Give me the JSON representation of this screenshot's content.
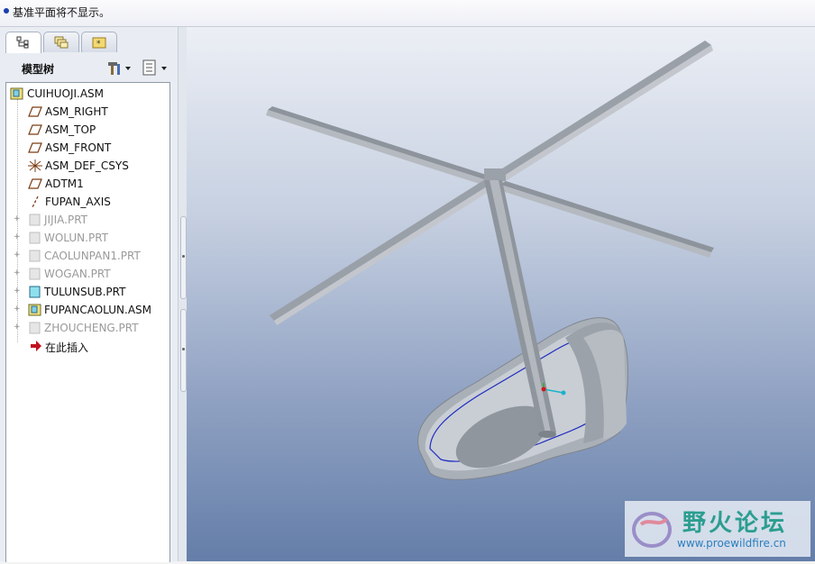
{
  "message_bar": {
    "text": "基准平面将不显示。"
  },
  "left_panel": {
    "tabs": [
      {
        "name": "model-tree-tab",
        "icon": "model-tree-icon"
      },
      {
        "name": "folder-browser-tab",
        "icon": "layers-icon"
      },
      {
        "name": "favorites-tab",
        "icon": "favorites-folder-icon"
      }
    ],
    "tree_title": "模型树",
    "tools": {
      "settings_icon": "hammer-settings-icon",
      "show_icon": "list-show-icon"
    }
  },
  "tree": {
    "root": "CUIHUOJI.ASM",
    "items": [
      {
        "label": "ASM_RIGHT",
        "icon": "datum-plane-icon",
        "dim": false
      },
      {
        "label": "ASM_TOP",
        "icon": "datum-plane-icon",
        "dim": false
      },
      {
        "label": "ASM_FRONT",
        "icon": "datum-plane-icon",
        "dim": false
      },
      {
        "label": "ASM_DEF_CSYS",
        "icon": "csys-icon",
        "dim": false
      },
      {
        "label": "ADTM1",
        "icon": "datum-plane-icon",
        "dim": false
      },
      {
        "label": "FUPAN_AXIS",
        "icon": "datum-axis-icon",
        "dim": false
      },
      {
        "label": "JIJIA.PRT",
        "icon": "part-icon",
        "dim": true
      },
      {
        "label": "WOLUN.PRT",
        "icon": "part-icon",
        "dim": true
      },
      {
        "label": "CAOLUNPAN1.PRT",
        "icon": "part-icon",
        "dim": true
      },
      {
        "label": "WOGAN.PRT",
        "icon": "part-icon",
        "dim": true
      },
      {
        "label": "TULUNSUB.PRT",
        "icon": "part-icon",
        "dim": false
      },
      {
        "label": "FUPANCAOLUN.ASM",
        "icon": "assembly-icon",
        "dim": false
      },
      {
        "label": "ZHOUCHENG.PRT",
        "icon": "part-icon",
        "dim": true
      }
    ],
    "insert_here": "在此插入"
  },
  "watermark": {
    "cn": "野火论坛",
    "url": "www.proewildfire.cn"
  }
}
